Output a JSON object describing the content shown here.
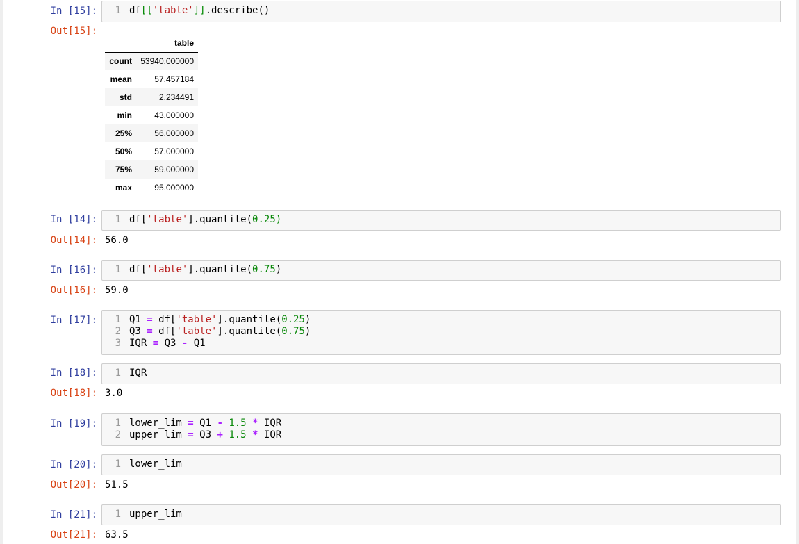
{
  "cells": [
    {
      "in_prompt": "In [15]:",
      "code": [
        [
          {
            "t": "df"
          },
          {
            "t": "[[",
            "c": "br"
          },
          {
            "t": "'table'",
            "c": "str"
          },
          {
            "t": "]]",
            "c": "br"
          },
          {
            "t": ".describe()"
          }
        ]
      ],
      "out_prompt": "Out[15]:",
      "table": {
        "header": [
          "",
          "table"
        ],
        "rows": [
          [
            "count",
            "53940.000000"
          ],
          [
            "mean",
            "57.457184"
          ],
          [
            "std",
            "2.234491"
          ],
          [
            "min",
            "43.000000"
          ],
          [
            "25%",
            "56.000000"
          ],
          [
            "50%",
            "57.000000"
          ],
          [
            "75%",
            "59.000000"
          ],
          [
            "max",
            "95.000000"
          ]
        ]
      }
    },
    {
      "in_prompt": "In [14]:",
      "code": [
        [
          {
            "t": "df["
          },
          {
            "t": "'table'",
            "c": "str"
          },
          {
            "t": "].quantile("
          },
          {
            "t": "0.25",
            "c": "num"
          },
          {
            "t": ")",
            "c": "br"
          }
        ]
      ],
      "out_prompt": "Out[14]:",
      "output": "56.0"
    },
    {
      "in_prompt": "In [16]:",
      "code": [
        [
          {
            "t": "df["
          },
          {
            "t": "'table'",
            "c": "str"
          },
          {
            "t": "].quantile("
          },
          {
            "t": "0.75",
            "c": "num"
          },
          {
            "t": ")"
          }
        ]
      ],
      "out_prompt": "Out[16]:",
      "output": "59.0"
    },
    {
      "in_prompt": "In [17]:",
      "code": [
        [
          {
            "t": "Q1 "
          },
          {
            "t": "=",
            "c": "op"
          },
          {
            "t": " df["
          },
          {
            "t": "'table'",
            "c": "str"
          },
          {
            "t": "].quantile("
          },
          {
            "t": "0.25",
            "c": "num"
          },
          {
            "t": ")"
          }
        ],
        [
          {
            "t": "Q3 "
          },
          {
            "t": "=",
            "c": "op"
          },
          {
            "t": " df["
          },
          {
            "t": "'table'",
            "c": "str"
          },
          {
            "t": "].quantile("
          },
          {
            "t": "0.75",
            "c": "num"
          },
          {
            "t": ")"
          }
        ],
        [
          {
            "t": "IQR "
          },
          {
            "t": "=",
            "c": "op"
          },
          {
            "t": " Q3 "
          },
          {
            "t": "-",
            "c": "op"
          },
          {
            "t": " Q1"
          }
        ]
      ]
    },
    {
      "in_prompt": "In [18]:",
      "code": [
        [
          {
            "t": "IQR"
          }
        ]
      ],
      "out_prompt": "Out[18]:",
      "output": "3.0"
    },
    {
      "in_prompt": "In [19]:",
      "code": [
        [
          {
            "t": "lower_lim "
          },
          {
            "t": "=",
            "c": "op"
          },
          {
            "t": " Q1 "
          },
          {
            "t": "-",
            "c": "op"
          },
          {
            "t": " "
          },
          {
            "t": "1.5",
            "c": "num"
          },
          {
            "t": " "
          },
          {
            "t": "*",
            "c": "op"
          },
          {
            "t": " IQR"
          }
        ],
        [
          {
            "t": "upper_lim "
          },
          {
            "t": "=",
            "c": "op"
          },
          {
            "t": " Q3 "
          },
          {
            "t": "+",
            "c": "op"
          },
          {
            "t": " "
          },
          {
            "t": "1.5",
            "c": "num"
          },
          {
            "t": " "
          },
          {
            "t": "*",
            "c": "op"
          },
          {
            "t": " IQR"
          }
        ]
      ]
    },
    {
      "in_prompt": "In [20]:",
      "code": [
        [
          {
            "t": "lower_lim"
          }
        ]
      ],
      "out_prompt": "Out[20]:",
      "output": "51.5"
    },
    {
      "in_prompt": "In [21]:",
      "code": [
        [
          {
            "t": "upper_lim"
          }
        ]
      ],
      "out_prompt": "Out[21]:",
      "output": "63.5"
    }
  ]
}
